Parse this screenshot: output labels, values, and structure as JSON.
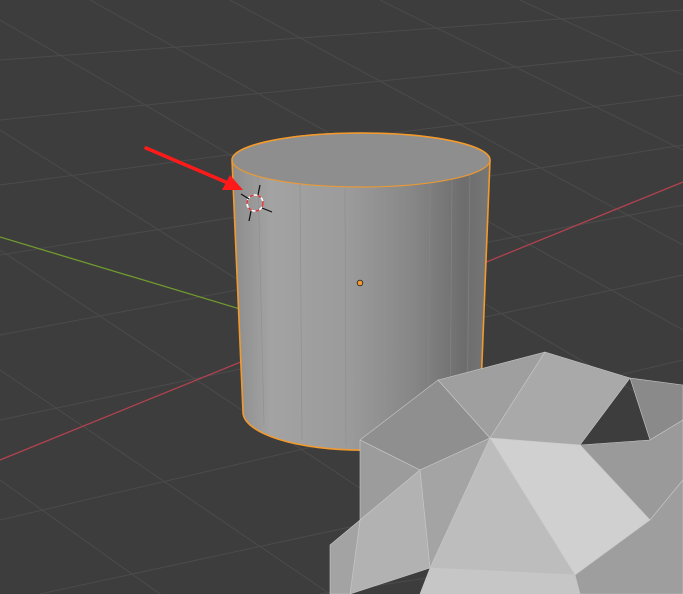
{
  "viewport": {
    "background": "#3d3d3d",
    "grid_color": "#4b4b4b",
    "x_axis_color": "#b0424f",
    "y_axis_color": "#6f9a2e"
  },
  "objects": {
    "cylinder": {
      "name": "cylinder",
      "selected": true,
      "outline_color": "#f29a2e",
      "body_color": "#9a9a9a"
    },
    "icosphere": {
      "name": "icosphere",
      "selected": false,
      "body_color": "#a8a8a8"
    }
  },
  "cursor": {
    "icon": "3d-cursor-icon",
    "color": "#d43b3b"
  },
  "annotation": {
    "icon": "red-arrow-icon",
    "color": "#ff1a1a"
  },
  "origin": {
    "icon": "object-origin-icon",
    "color": "#f29a2e"
  }
}
